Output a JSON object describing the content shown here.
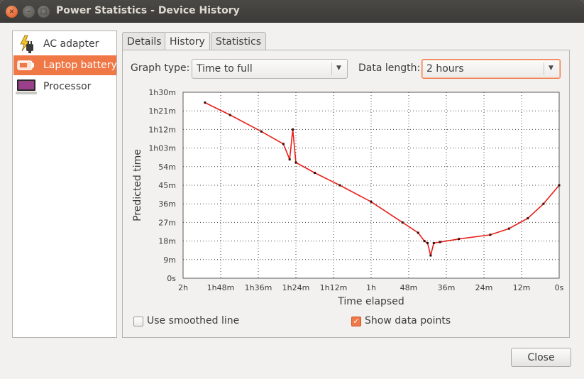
{
  "window": {
    "title": "Power Statistics - Device History",
    "buttons": {
      "close_icon": "×",
      "min_icon": "–",
      "max_icon": "□"
    }
  },
  "sidebar": {
    "items": [
      {
        "label": "AC adapter",
        "icon": "ac-adapter-icon",
        "selected": false
      },
      {
        "label": "Laptop battery",
        "icon": "battery-icon",
        "selected": true
      },
      {
        "label": "Processor",
        "icon": "processor-icon",
        "selected": false
      }
    ]
  },
  "tabs": [
    {
      "label": "Details",
      "active": false
    },
    {
      "label": "History",
      "active": true
    },
    {
      "label": "Statistics",
      "active": false
    }
  ],
  "controls": {
    "graph_type_label": "Graph type:",
    "graph_type_value": "Time to full",
    "data_length_label": "Data length:",
    "data_length_value": "2 hours",
    "smoothed_label": "Use smoothed line",
    "smoothed_checked": false,
    "datapoints_label": "Show data points",
    "datapoints_checked": true
  },
  "footer": {
    "close_label": "Close"
  },
  "colors": {
    "accent": "#f07746",
    "line": "#e8201a",
    "point": "#3a0c0c"
  },
  "chart_data": {
    "type": "line",
    "xlabel": "Time elapsed",
    "ylabel": "Predicted time",
    "x_ticks": [
      "2h",
      "1h48m",
      "1h36m",
      "1h24m",
      "1h12m",
      "1h",
      "48m",
      "36m",
      "24m",
      "12m",
      "0s"
    ],
    "y_ticks": [
      "0s",
      "9m",
      "18m",
      "27m",
      "36m",
      "45m",
      "54m",
      "1h03m",
      "1h12m",
      "1h21m",
      "1h30m"
    ],
    "x_unit": "minutes ago",
    "y_unit": "minutes",
    "xlim": [
      120,
      0
    ],
    "ylim": [
      0,
      90
    ],
    "grid": true,
    "series": [
      {
        "points": [
          [
            113,
            85
          ],
          [
            105,
            79
          ],
          [
            95,
            71
          ],
          [
            88,
            65
          ],
          [
            86,
            57.5
          ],
          [
            85,
            72
          ],
          [
            84,
            56
          ],
          [
            78,
            51
          ],
          [
            70,
            45
          ],
          [
            60,
            37
          ],
          [
            50,
            27
          ],
          [
            45,
            22
          ],
          [
            43,
            18
          ],
          [
            42,
            17
          ],
          [
            41,
            11
          ],
          [
            40,
            17
          ],
          [
            38,
            17.5
          ],
          [
            32,
            19
          ],
          [
            22,
            21
          ],
          [
            16,
            24
          ],
          [
            10,
            29
          ],
          [
            5,
            36
          ],
          [
            0,
            45
          ]
        ]
      }
    ]
  }
}
